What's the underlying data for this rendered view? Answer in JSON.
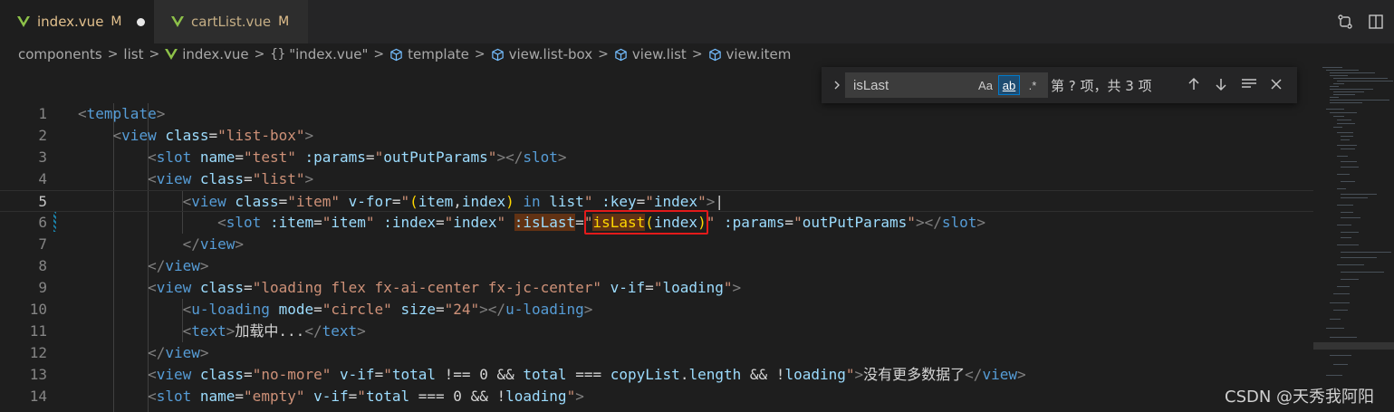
{
  "tabs": [
    {
      "name": "index.vue",
      "status": "M",
      "unsaved": true
    },
    {
      "name": "cartList.vue",
      "status": "M",
      "unsaved": false
    }
  ],
  "breadcrumb": {
    "segments": [
      "components",
      "list",
      "index.vue",
      "\"index.vue\"",
      "template",
      "view.list-box",
      "view.list",
      "view.item"
    ],
    "separator": ">"
  },
  "find": {
    "query": "isLast",
    "match_case_label": "Aa",
    "whole_word_label": "ab",
    "regex_label": ".*",
    "result": "第 ? 项，共 3 项"
  },
  "editor": {
    "line_numbers": [
      "1",
      "2",
      "3",
      "4",
      "5",
      "6",
      "7",
      "8",
      "9",
      "10",
      "11",
      "12",
      "13",
      "14"
    ],
    "current_line": 5
  },
  "colors": {
    "tag": "#569cd6",
    "attr": "#9cdcfe",
    "string": "#ce9178",
    "highlight_border": "#e31a1a"
  },
  "watermark": "CSDN @天秀我阿阳"
}
